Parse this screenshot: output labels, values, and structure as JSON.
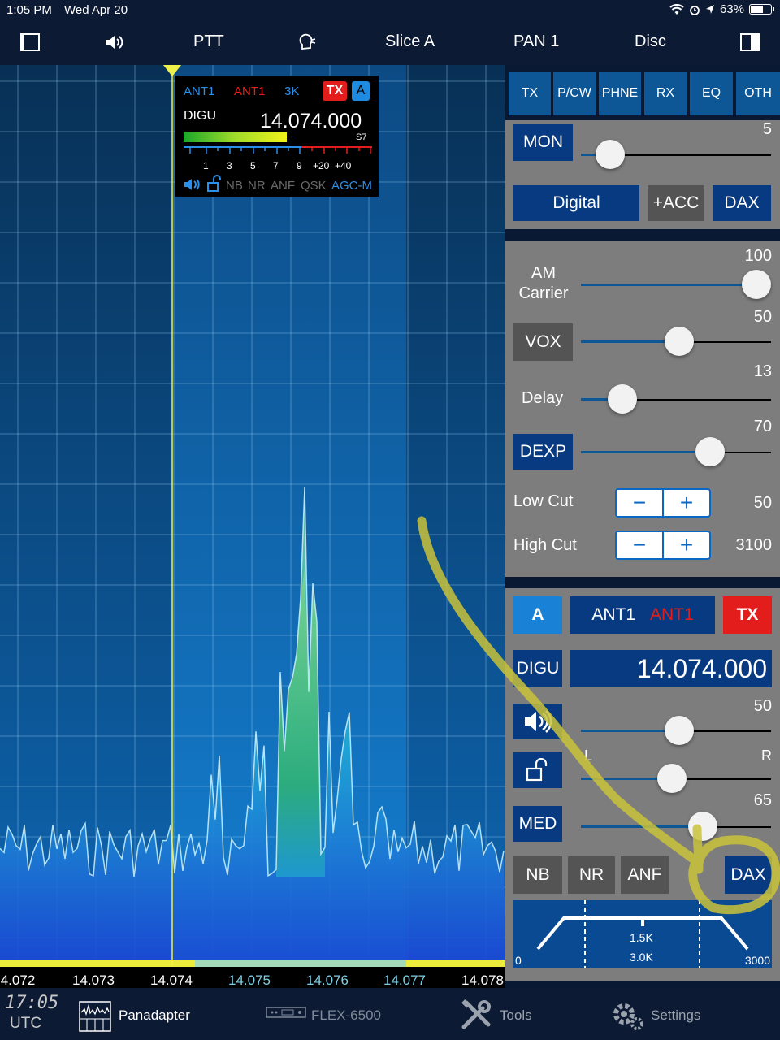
{
  "status": {
    "time": "1:05 PM",
    "date": "Wed Apr 20",
    "battery": "63%",
    "battery_level": 0.63
  },
  "nav": {
    "ptt": "PTT",
    "slice": "Slice A",
    "pan": "PAN 1",
    "disc": "Disc"
  },
  "flag": {
    "rx_ant": "ANT1",
    "tx_ant": "ANT1",
    "filter": "3K",
    "tx": "TX",
    "letter": "A",
    "mode": "DIGU",
    "freq": "14.074.000",
    "s_reading": "S7",
    "signal_level": 0.55,
    "scale": [
      "1",
      "3",
      "5",
      "7",
      "9",
      "+20",
      "+40"
    ],
    "features": [
      "NB",
      "NR",
      "ANF",
      "QSK",
      "AGC-M"
    ]
  },
  "freq_axis": [
    "4.072",
    "14.073",
    "14.074",
    "14.075",
    "14.076",
    "14.077",
    "14.078"
  ],
  "panel": {
    "tabs": [
      "TX",
      "P/CW",
      "PHNE",
      "RX",
      "EQ",
      "OTH"
    ],
    "mon": {
      "label": "MON",
      "value": "5",
      "level": 0.05
    },
    "digital": "Digital",
    "acc": "+ACC",
    "dax": "DAX",
    "am_carrier": {
      "label": "AM Carrier",
      "value": "100",
      "level": 1.0
    },
    "vox": {
      "label": "VOX",
      "value": "50",
      "level": 0.5
    },
    "delay": {
      "label": "Delay",
      "value": "13",
      "level": 0.13
    },
    "dexp": {
      "label": "DEXP",
      "value": "70",
      "level": 0.7
    },
    "low_cut": {
      "label": "Low Cut",
      "value": "50"
    },
    "high_cut": {
      "label": "High Cut",
      "value": "3100"
    },
    "slice": {
      "letter": "A",
      "rx_ant": "ANT1",
      "tx_ant": "ANT1",
      "tx": "TX",
      "mode": "DIGU",
      "freq": "14.074.000",
      "volume": {
        "value": "50",
        "level": 0.5
      },
      "pan_l": "L",
      "pan_r": "R",
      "pan_level": 0.45,
      "agc_label": "MED",
      "agc": {
        "value": "65",
        "level": 0.65
      },
      "nb": "NB",
      "nr": "NR",
      "anf": "ANF",
      "dax": "DAX",
      "filter": {
        "low": "0",
        "high": "3000",
        "center": "1.5K",
        "width": "3.0K"
      }
    }
  },
  "bottom": {
    "clock": "17:05",
    "tz": "UTC",
    "panadapter": "Panadapter",
    "radio": "FLEX-6500",
    "tools": "Tools",
    "settings": "Settings"
  },
  "colors": {
    "accent_blue": "#0d5796",
    "tx_red": "#e31c1c",
    "panel_gray": "#7d7d7d",
    "annotation_yellow": "#c9c23a"
  }
}
